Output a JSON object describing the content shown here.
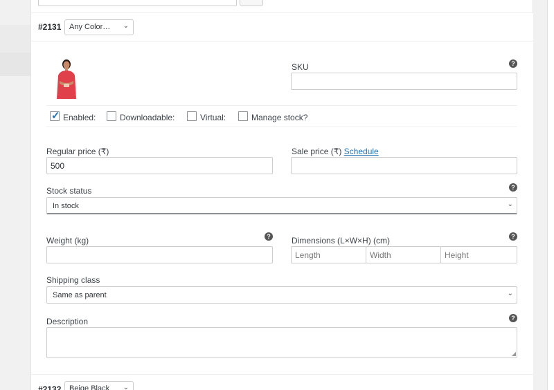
{
  "variations": [
    {
      "id": "#2131",
      "attribute": "Any Color…"
    },
    {
      "id": "#2132",
      "attribute": "Beige Black"
    }
  ],
  "sku": {
    "label": "SKU",
    "value": ""
  },
  "options": [
    {
      "label": "Enabled:",
      "checked": true
    },
    {
      "label": "Downloadable:",
      "checked": false
    },
    {
      "label": "Virtual:",
      "checked": false
    },
    {
      "label": "Manage stock?",
      "checked": false
    }
  ],
  "regular_price": {
    "label": "Regular price (₹)",
    "value": "500"
  },
  "sale_price": {
    "label": "Sale price (₹)",
    "schedule_link": "Schedule",
    "value": ""
  },
  "stock_status": {
    "label": "Stock status",
    "value": "In stock"
  },
  "weight": {
    "label": "Weight (kg)",
    "value": ""
  },
  "dimensions": {
    "label": "Dimensions (L×W×H) (cm)",
    "length_placeholder": "Length",
    "width_placeholder": "Width",
    "height_placeholder": "Height"
  },
  "shipping_class": {
    "label": "Shipping class",
    "value": "Same as parent"
  },
  "description": {
    "label": "Description",
    "value": ""
  },
  "icons": {
    "help": "help-icon",
    "chevron": "chevron-down-icon",
    "check": "checkmark-icon"
  },
  "colors": {
    "accent": "#2271b1",
    "border": "#cccccc",
    "text": "#3c434a"
  }
}
